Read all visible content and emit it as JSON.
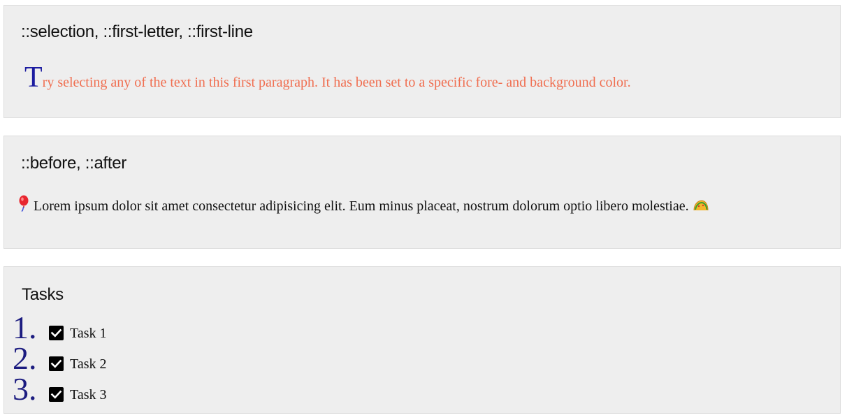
{
  "cards": [
    {
      "title": "::selection, ::first-letter, ::first-line",
      "first_letter": "T",
      "text_rest": "ry selecting any of the text in this first paragraph. It has been set to a specific fore- and background color."
    },
    {
      "title": "::before, ::after",
      "before_icon": "balloon-icon",
      "text": "Lorem ipsum dolor sit amet consectetur adipisicing elit. Eum minus placeat, nostrum dolorum optio libero molestiae.",
      "after_icon": "taco-icon"
    },
    {
      "title": "Tasks",
      "tasks": [
        {
          "number": "1.",
          "label": "Task 1",
          "checked": true
        },
        {
          "number": "2.",
          "label": "Task 2",
          "checked": true
        },
        {
          "number": "3.",
          "label": "Task 3",
          "checked": true
        }
      ]
    }
  ],
  "colors": {
    "card_bg": "#eeeeee",
    "card_border": "#dcdcdc",
    "first_line_text": "#f06e50",
    "first_letter": "#1c1ca0",
    "list_number": "#1c1c80"
  }
}
